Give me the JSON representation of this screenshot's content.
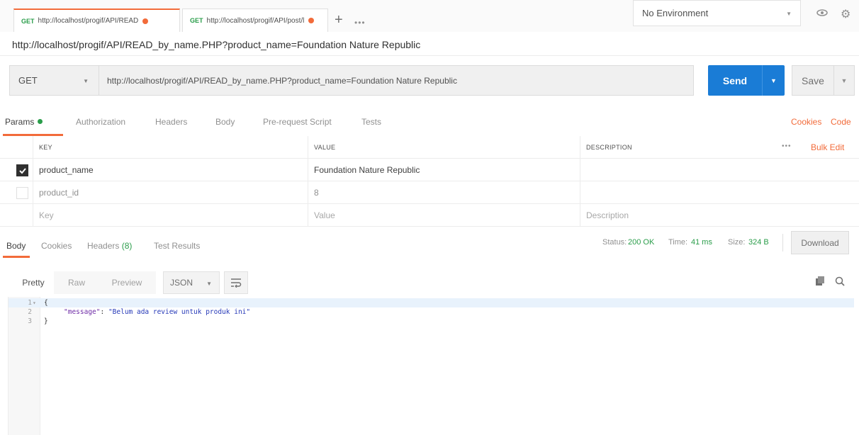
{
  "tabs": [
    {
      "method": "GET",
      "url": "http://localhost/progif/API/READ"
    },
    {
      "method": "GET",
      "url": "http://localhost/progif/API/post/l"
    }
  ],
  "tab_controls": {
    "plus": "+",
    "more": "•••"
  },
  "environment": {
    "selected": "No Environment"
  },
  "request": {
    "title": "http://localhost/progif/API/READ_by_name.PHP?product_name=Foundation Nature Republic",
    "method": "GET",
    "url": "http://localhost/progif/API/READ_by_name.PHP?product_name=Foundation Nature Republic",
    "send_label": "Send",
    "save_label": "Save"
  },
  "request_tabs": [
    "Params",
    "Authorization",
    "Headers",
    "Body",
    "Pre-request Script",
    "Tests"
  ],
  "request_links": {
    "cookies": "Cookies",
    "code": "Code"
  },
  "params": {
    "headers": {
      "key": "KEY",
      "value": "VALUE",
      "description": "DESCRIPTION"
    },
    "more": "•••",
    "bulk_edit": "Bulk Edit",
    "rows": [
      {
        "checked": true,
        "key": "product_name",
        "value": "Foundation Nature Republic",
        "description": ""
      },
      {
        "checked": false,
        "key": "product_id",
        "value": "8",
        "description": ""
      }
    ],
    "placeholder": {
      "key": "Key",
      "value": "Value",
      "description": "Description"
    }
  },
  "response_tabs": {
    "body": "Body",
    "cookies": "Cookies",
    "headers": "Headers",
    "headers_count": "(8)",
    "test_results": "Test Results"
  },
  "status": {
    "status_label": "Status:",
    "status_value": "200 OK",
    "time_label": "Time:",
    "time_value": "41 ms",
    "size_label": "Size:",
    "size_value": "324 B",
    "download": "Download"
  },
  "body_toolbar": {
    "pretty": "Pretty",
    "raw": "Raw",
    "preview": "Preview",
    "format": "JSON"
  },
  "code_lines": [
    {
      "num": "1",
      "fold": "▾",
      "text": "{"
    },
    {
      "num": "2",
      "fold": "",
      "key": "\"message\"",
      "sep": ": ",
      "value": "\"Belum ada review untuk produk ini\""
    },
    {
      "num": "3",
      "fold": "",
      "text": "}"
    }
  ],
  "colors": {
    "accent": "#f26b3a",
    "send": "#1a7cd6",
    "success": "#2a9d4a"
  }
}
